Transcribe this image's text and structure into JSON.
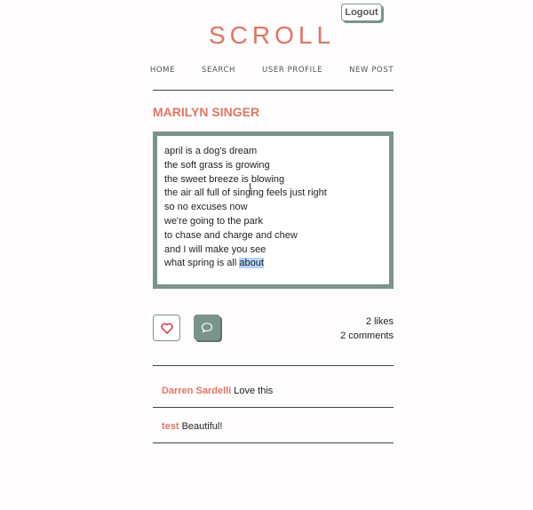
{
  "header": {
    "logout_label": "Logout",
    "brand": "SCROLL",
    "nav": [
      "HOME",
      "SEARCH",
      "USER PROFILE",
      "NEW POST"
    ]
  },
  "post": {
    "author": "MARILYN SINGER",
    "lines": [
      "april is a dog's dream",
      "the soft grass is growing",
      "the sweet breeze is blowing",
      "the air all full of singing feels just right",
      "so no excuses now",
      "we're going to the park",
      "to chase and charge and chew",
      "and I will make you see",
      "what spring is all"
    ],
    "selected_word": "about",
    "likes": "2 likes",
    "comments_count": "2 comments"
  },
  "comments": [
    {
      "author": "Darren Sardelli",
      "text": "Love this"
    },
    {
      "author": "test",
      "text": "Beautiful!"
    }
  ],
  "icons": {
    "like": "heart-icon",
    "comment": "speech-bubble-icon"
  },
  "colors": {
    "accent": "#e17563",
    "frame": "#7b938d",
    "selection": "#b4d5fe"
  }
}
